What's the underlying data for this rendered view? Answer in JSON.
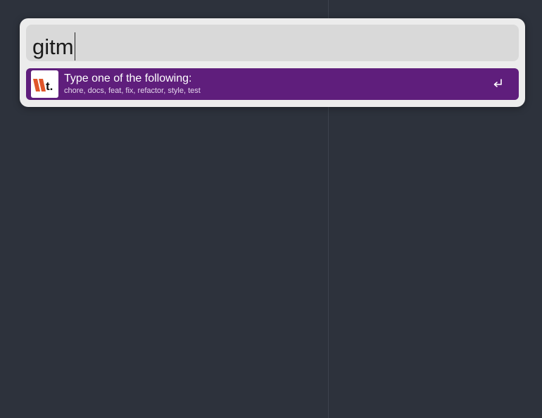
{
  "launcher": {
    "query": "gitm",
    "result": {
      "title": "Type one of the following:",
      "subtitle": "chore, docs, feat, fix, refactor, style, test",
      "icon": "app-logo-icon",
      "action_icon": "return-key-icon"
    }
  },
  "colors": {
    "background": "#2d323c",
    "panel": "#ececec",
    "search_field": "#d9d9d9",
    "selected_row": "#5f1e7c",
    "logo_orange": "#e0562a"
  }
}
